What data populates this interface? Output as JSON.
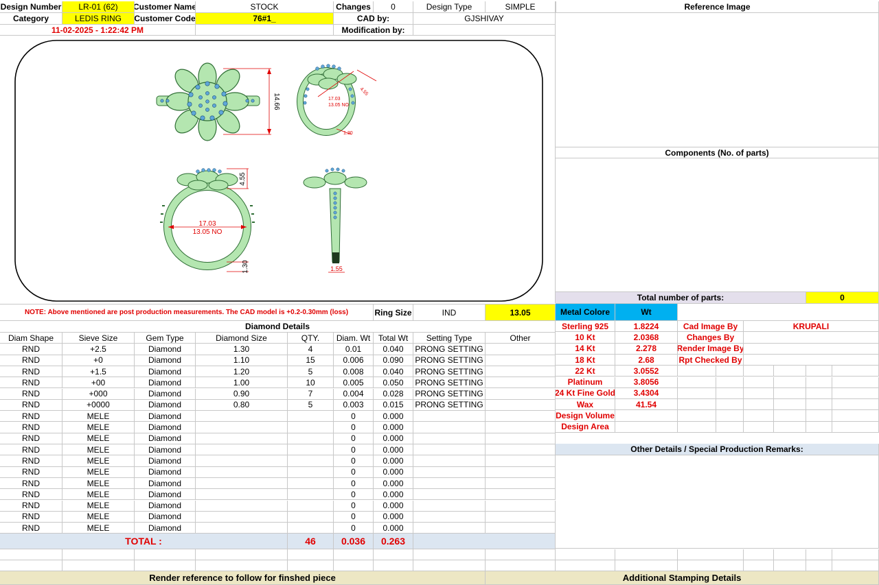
{
  "header": {
    "design_number_label": "Design Number",
    "design_number": "LR-01 (62)",
    "customer_name_label": "Customer Name",
    "customer_name": "STOCK",
    "changes_label": "Changes",
    "changes": "0",
    "design_type_label": "Design Type",
    "design_type": "SIMPLE",
    "reference_image_label": "Reference Image",
    "category_label": "Category",
    "category": "LEDIS RING",
    "customer_code_label": "Customer Code",
    "customer_code": "76#1_",
    "cad_by_label": "CAD by:",
    "cad_by": "GJSHIVAY",
    "datetime": "11-02-2025 - 1:22:42 PM",
    "modification_by_label": "Modification by:"
  },
  "drawing": {
    "dim_height": "14.66",
    "dim_top": "4.55",
    "dim_inner": "17.03",
    "dim_size": "13.05 NO",
    "dim_shank": "1.30",
    "dim_width": "1.55",
    "dim_side_a": "17.03",
    "dim_side_b": "13.05 NO",
    "dim_side_c": "4.55",
    "dim_side_d": "1.30"
  },
  "note": {
    "text": "NOTE: Above mentioned are post production measurements. The CAD model is +0.2-0.30mm (loss)",
    "ring_size_label": "Ring Size",
    "ring_size_std": "IND",
    "ring_size": "13.05"
  },
  "components": {
    "label": "Components (No. of parts)",
    "total_parts_label": "Total number of parts:",
    "total_parts": "0"
  },
  "diamond": {
    "title": "Diamond Details",
    "columns": [
      "Diam Shape",
      "Sieve Size",
      "Gem Type",
      "Diamond Size",
      "QTY.",
      "Diam. Wt",
      "Total Wt",
      "Setting Type",
      "Other"
    ],
    "rows": [
      [
        "RND",
        "+2.5",
        "Diamond",
        "1.30",
        "4",
        "0.01",
        "0.040",
        "PRONG SETTING",
        ""
      ],
      [
        "RND",
        "+0",
        "Diamond",
        "1.10",
        "15",
        "0.006",
        "0.090",
        "PRONG SETTING",
        ""
      ],
      [
        "RND",
        "+1.5",
        "Diamond",
        "1.20",
        "5",
        "0.008",
        "0.040",
        "PRONG SETTING",
        ""
      ],
      [
        "RND",
        "+00",
        "Diamond",
        "1.00",
        "10",
        "0.005",
        "0.050",
        "PRONG SETTING",
        ""
      ],
      [
        "RND",
        "+000",
        "Diamond",
        "0.90",
        "7",
        "0.004",
        "0.028",
        "PRONG SETTING",
        ""
      ],
      [
        "RND",
        "+0000",
        "Diamond",
        "0.80",
        "5",
        "0.003",
        "0.015",
        "PRONG SETTING",
        ""
      ],
      [
        "RND",
        "MELE",
        "Diamond",
        "",
        "",
        "0",
        "0.000",
        "",
        ""
      ],
      [
        "RND",
        "MELE",
        "Diamond",
        "",
        "",
        "0",
        "0.000",
        "",
        ""
      ],
      [
        "RND",
        "MELE",
        "Diamond",
        "",
        "",
        "0",
        "0.000",
        "",
        ""
      ],
      [
        "RND",
        "MELE",
        "Diamond",
        "",
        "",
        "0",
        "0.000",
        "",
        ""
      ],
      [
        "RND",
        "MELE",
        "Diamond",
        "",
        "",
        "0",
        "0.000",
        "",
        ""
      ],
      [
        "RND",
        "MELE",
        "Diamond",
        "",
        "",
        "0",
        "0.000",
        "",
        ""
      ],
      [
        "RND",
        "MELE",
        "Diamond",
        "",
        "",
        "0",
        "0.000",
        "",
        ""
      ],
      [
        "RND",
        "MELE",
        "Diamond",
        "",
        "",
        "0",
        "0.000",
        "",
        ""
      ],
      [
        "RND",
        "MELE",
        "Diamond",
        "",
        "",
        "0",
        "0.000",
        "",
        ""
      ],
      [
        "RND",
        "MELE",
        "Diamond",
        "",
        "",
        "0",
        "0.000",
        "",
        ""
      ],
      [
        "RND",
        "MELE",
        "Diamond",
        "",
        "",
        "0",
        "0.000",
        "",
        ""
      ]
    ],
    "total_label": "TOTAL :",
    "total_qty": "46",
    "total_diam_wt": "0.036",
    "total_wt": "0.263"
  },
  "metal": {
    "colore_label": "Metal Colore",
    "wt_label": "Wt",
    "rows": [
      [
        "Sterling 925",
        "1.8224"
      ],
      [
        "10 Kt",
        "2.0368"
      ],
      [
        "14 Kt",
        "2.278"
      ],
      [
        "18 Kt",
        "2.68"
      ],
      [
        "22 Kt",
        "3.0552"
      ],
      [
        "Platinum",
        "3.8056"
      ],
      [
        "24 Kt Fine Gold",
        "3.4304"
      ],
      [
        "Wax",
        "41.54"
      ],
      [
        "Design Volume",
        ""
      ],
      [
        "Design Area",
        ""
      ]
    ],
    "people": [
      [
        "Cad Image By",
        "KRUPALI"
      ],
      [
        "Changes By",
        ""
      ],
      [
        "Render Image By",
        ""
      ],
      [
        "Rpt Checked By",
        ""
      ]
    ]
  },
  "other_details_label": "Other Details / Special Production Remarks:",
  "footer": {
    "render_reference": "Render reference to follow for finshed piece",
    "stamping": "Additional Stamping Details"
  },
  "colors": {
    "ring_green": "#b4e6b0",
    "ring_stroke": "#2f6e35",
    "stone_blue": "#5fa8d8",
    "dim_red": "#e00000"
  }
}
